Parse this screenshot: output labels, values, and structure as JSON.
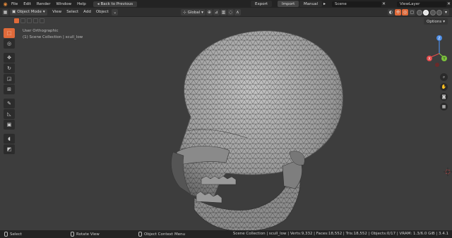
{
  "topbar": {
    "menus": [
      "File",
      "Edit",
      "Render",
      "Window",
      "Help"
    ],
    "back_label": "Back to Previous",
    "export_label": "Export",
    "import_label": "Import",
    "manual_label": "Manual",
    "scene_value": "Scene",
    "viewlayer_value": "ViewLayer"
  },
  "header": {
    "mode": "Object Mode",
    "menus": [
      "View",
      "Select",
      "Add",
      "Object"
    ],
    "transform_orientation": "Global",
    "options_label": "Options"
  },
  "viewport": {
    "view_name": "User Orthographic",
    "collection_info": "(1) Scene Collection | scull_low",
    "gizmo": {
      "x_label": "X",
      "y_label": "Y",
      "z_label": "Z"
    }
  },
  "toolbar": {
    "tools": [
      "select-box",
      "cursor",
      "move",
      "rotate",
      "scale",
      "transform",
      "annotate",
      "measure",
      "add-cube",
      "shrink",
      "spin"
    ]
  },
  "statusbar": {
    "select_label": "Select",
    "rotate_label": "Rotate View",
    "context_label": "Object Context Menu",
    "stats": "Scene Collection | scull_low | Verts:9,332 | Faces:18,552 | Tris:18,552 | Objects:0/17 | VRAM: 1.3/6.0 GiB | 3.4.1"
  },
  "colors": {
    "accent": "#e06a3a",
    "viewport_bg": "#3d3d3d",
    "axis_x": "#e44c4c",
    "axis_y": "#7cc33c",
    "axis_z": "#4c8ce4"
  }
}
